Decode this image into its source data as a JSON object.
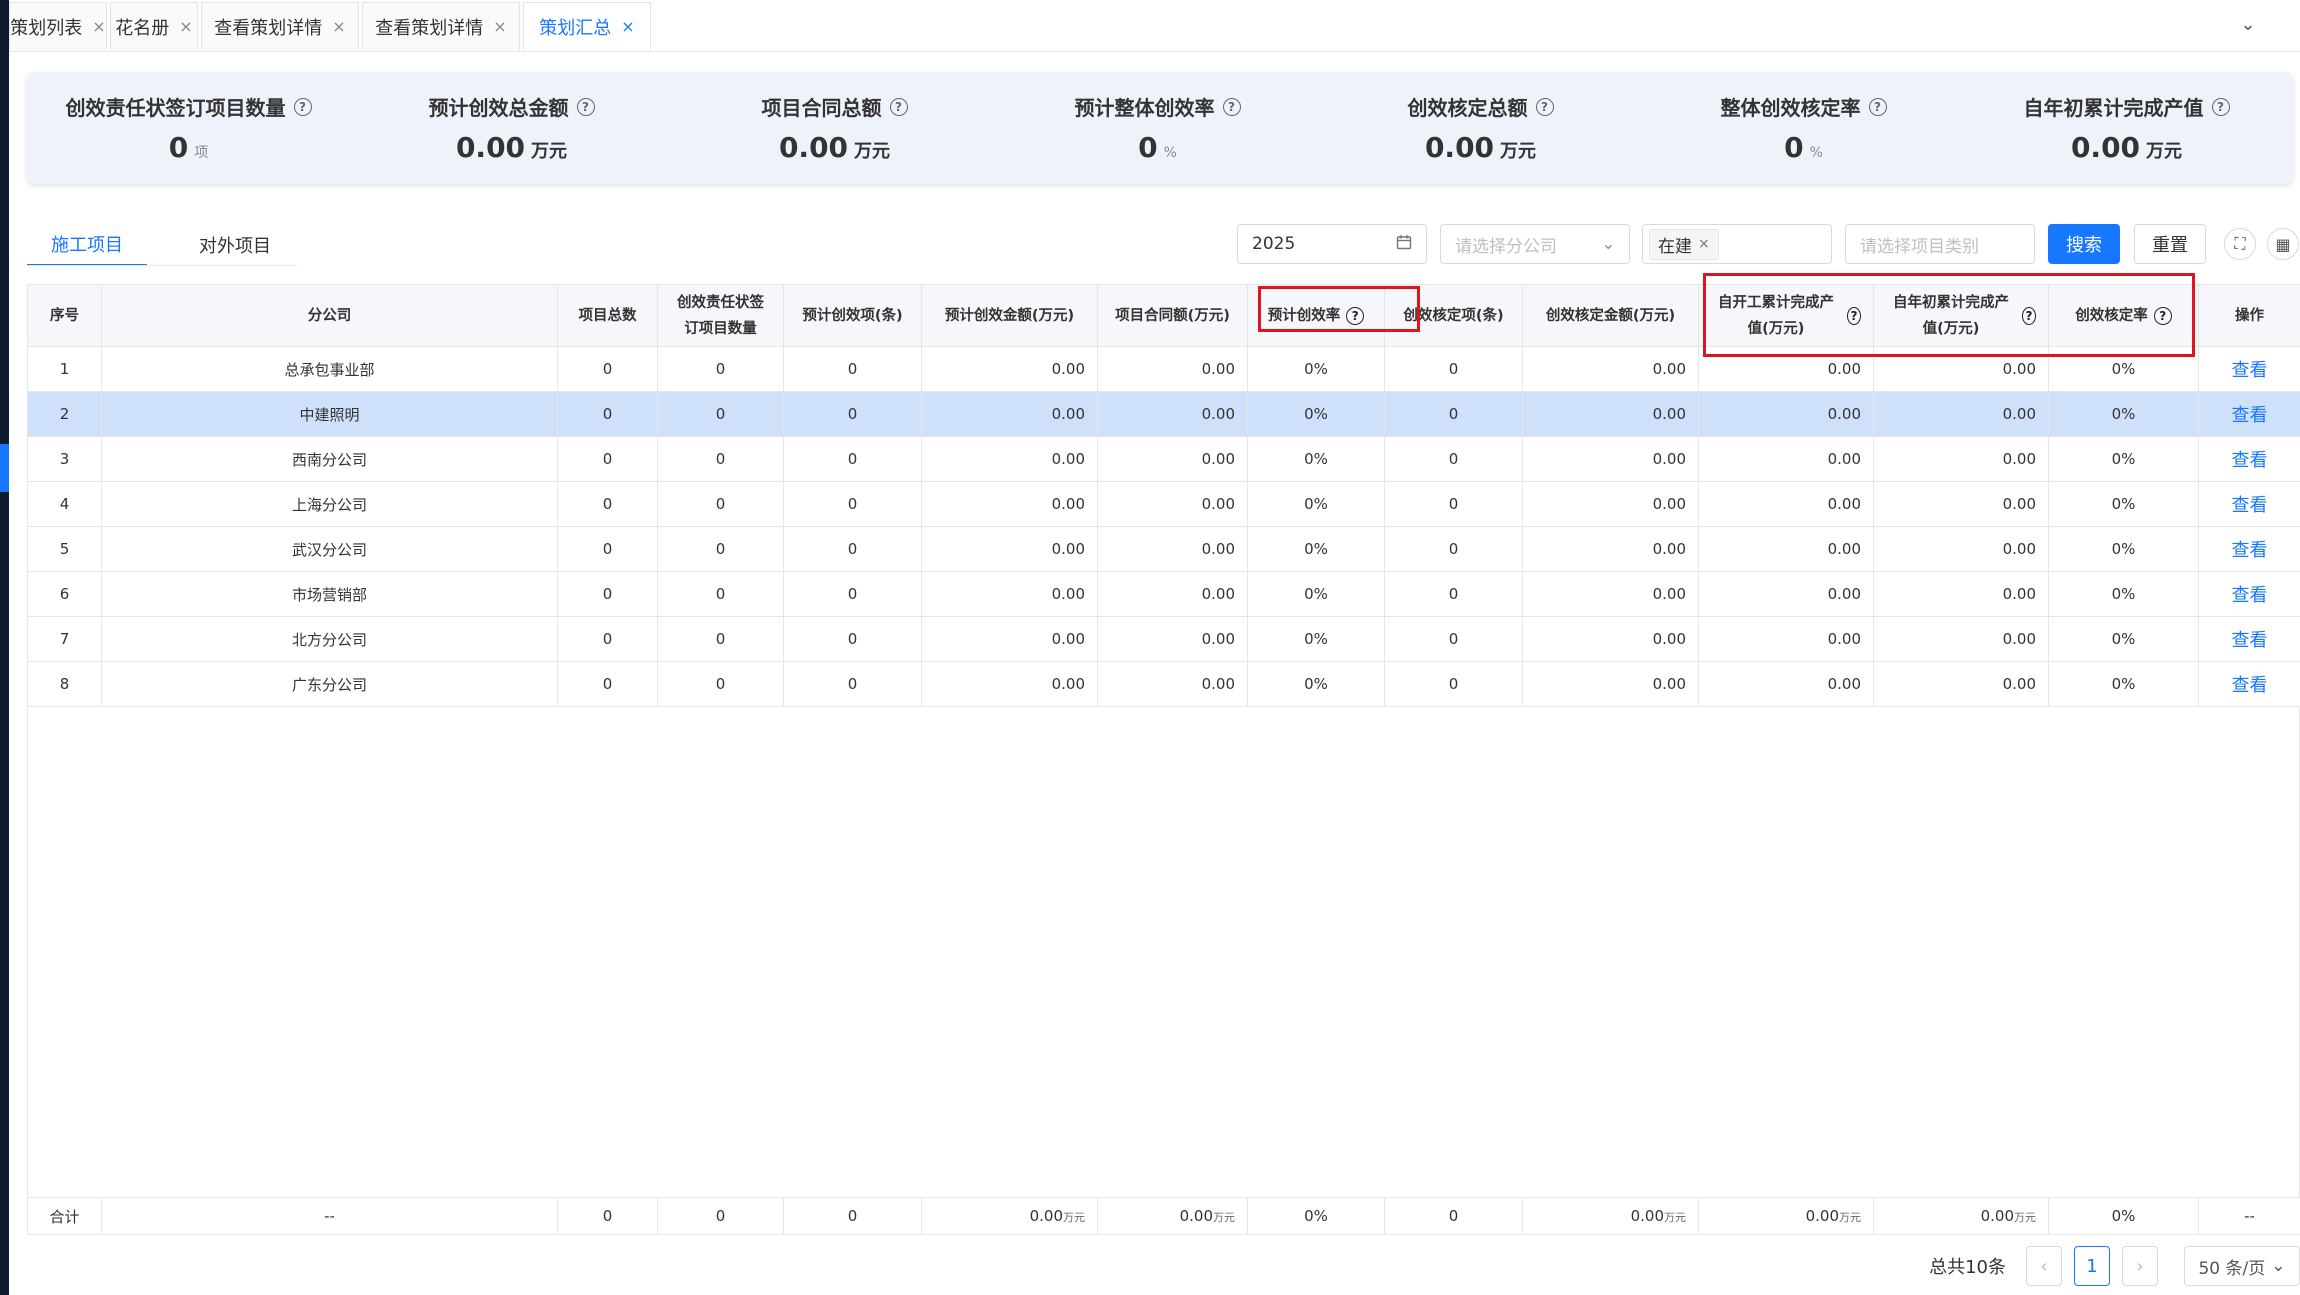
{
  "tabs": [
    {
      "label": "策划列表",
      "active": false
    },
    {
      "label": "花名册",
      "active": false
    },
    {
      "label": "查看策划详情",
      "active": false
    },
    {
      "label": "查看策划详情",
      "active": false
    },
    {
      "label": "策划汇总",
      "active": true
    }
  ],
  "icons": {
    "close": "×",
    "collapse": "⌄",
    "help": "?",
    "calendar": "calendar-icon",
    "chevron": "⌄",
    "fullscreen": "⛶",
    "grid": "▦",
    "prev": "‹",
    "next": "›"
  },
  "stats": [
    {
      "label": "创效责任状签订项目数量",
      "value": "0",
      "unit": "项"
    },
    {
      "label": "预计创效总金额",
      "value": "0.00",
      "unit": "万元"
    },
    {
      "label": "项目合同总额",
      "value": "0.00",
      "unit": "万元"
    },
    {
      "label": "预计整体创效率",
      "value": "0",
      "unit": "%"
    },
    {
      "label": "创效核定总额",
      "value": "0.00",
      "unit": "万元"
    },
    {
      "label": "整体创效核定率",
      "value": "0",
      "unit": "%"
    },
    {
      "label": "自年初累计完成产值",
      "value": "0.00",
      "unit": "万元"
    }
  ],
  "subtabs": [
    {
      "label": "施工项目",
      "active": true
    },
    {
      "label": "对外项目",
      "active": false
    }
  ],
  "filters": {
    "year": "2025",
    "branch_placeholder": "请选择分公司",
    "status_chip": "在建",
    "category_placeholder": "请选择项目类别",
    "search_label": "搜索",
    "reset_label": "重置"
  },
  "table": {
    "columns": [
      {
        "label": "序号"
      },
      {
        "label": "分公司"
      },
      {
        "label": "项目总数"
      },
      {
        "label": "创效责任状签订项目数量"
      },
      {
        "label": "预计创效项(条)"
      },
      {
        "label": "预计创效金额(万元)"
      },
      {
        "label": "项目合同额(万元)"
      },
      {
        "label": "预计创效率",
        "help": true
      },
      {
        "label": "创效核定项(条)"
      },
      {
        "label": "创效核定金额(万元)"
      },
      {
        "label": "自开工累计完成产值(万元)",
        "help": true
      },
      {
        "label": "自年初累计完成产值(万元)",
        "help": true
      },
      {
        "label": "创效核定率",
        "help": true
      },
      {
        "label": "操作"
      }
    ],
    "rows": [
      [
        "1",
        "总承包事业部",
        "0",
        "0",
        "0",
        "0.00",
        "0.00",
        "0%",
        "0",
        "0.00",
        "0.00",
        "0.00",
        "0%",
        "查看"
      ],
      [
        "2",
        "中建照明",
        "0",
        "0",
        "0",
        "0.00",
        "0.00",
        "0%",
        "0",
        "0.00",
        "0.00",
        "0.00",
        "0%",
        "查看"
      ],
      [
        "3",
        "西南分公司",
        "0",
        "0",
        "0",
        "0.00",
        "0.00",
        "0%",
        "0",
        "0.00",
        "0.00",
        "0.00",
        "0%",
        "查看"
      ],
      [
        "4",
        "上海分公司",
        "0",
        "0",
        "0",
        "0.00",
        "0.00",
        "0%",
        "0",
        "0.00",
        "0.00",
        "0.00",
        "0%",
        "查看"
      ],
      [
        "5",
        "武汉分公司",
        "0",
        "0",
        "0",
        "0.00",
        "0.00",
        "0%",
        "0",
        "0.00",
        "0.00",
        "0.00",
        "0%",
        "查看"
      ],
      [
        "6",
        "市场营销部",
        "0",
        "0",
        "0",
        "0.00",
        "0.00",
        "0%",
        "0",
        "0.00",
        "0.00",
        "0.00",
        "0%",
        "查看"
      ],
      [
        "7",
        "北方分公司",
        "0",
        "0",
        "0",
        "0.00",
        "0.00",
        "0%",
        "0",
        "0.00",
        "0.00",
        "0.00",
        "0%",
        "查看"
      ],
      [
        "8",
        "广东分公司",
        "0",
        "0",
        "0",
        "0.00",
        "0.00",
        "0%",
        "0",
        "0.00",
        "0.00",
        "0.00",
        "0%",
        "查看"
      ]
    ],
    "highlight_row": 1,
    "summary": {
      "label": "合计",
      "branch": "--",
      "cells": [
        "0",
        "0",
        "0",
        "0.00",
        "0.00",
        "0%",
        "0",
        "0.00",
        "0.00",
        "0.00",
        "0%",
        "--"
      ],
      "unit": "万元"
    }
  },
  "pagination": {
    "total": "总共10条",
    "current_page": "1",
    "page_size": "50 条/页"
  },
  "colors": {
    "primary": "#1677ff",
    "highlight": "#cfe0fb",
    "annotation": "#e0141e"
  }
}
